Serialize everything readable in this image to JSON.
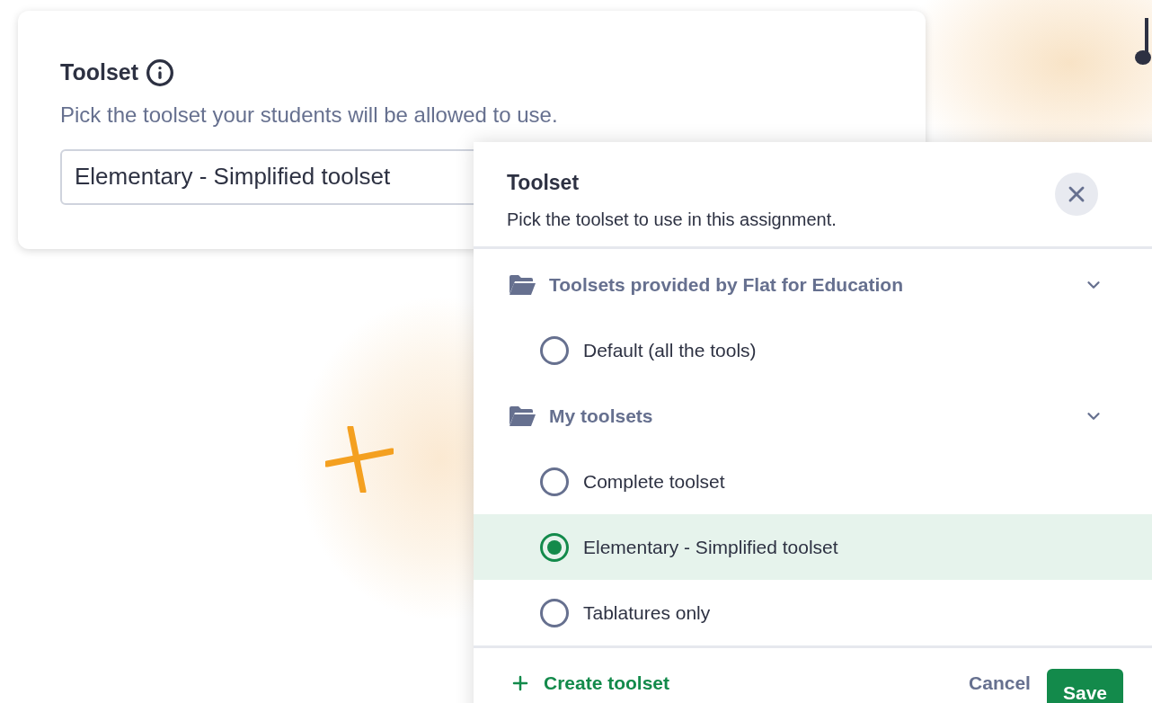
{
  "card": {
    "title": "Toolset",
    "description": "Pick the toolset your students will be allowed to use.",
    "select": {
      "value": "Elementary - Simplified toolset"
    }
  },
  "dialog": {
    "title": "Toolset",
    "subtitle": "Pick the toolset to use in this assignment.",
    "groups": [
      {
        "label": "Toolsets provided by Flat for Education",
        "expanded": true,
        "options": [
          {
            "label": "Default (all the tools)",
            "selected": false
          }
        ]
      },
      {
        "label": "My toolsets",
        "expanded": true,
        "options": [
          {
            "label": "Complete toolset",
            "selected": false
          },
          {
            "label": "Elementary - Simplified toolset",
            "selected": true
          },
          {
            "label": "Tablatures only",
            "selected": false
          }
        ]
      }
    ],
    "footer": {
      "create": "Create toolset",
      "cancel": "Cancel",
      "save": "Save"
    }
  }
}
